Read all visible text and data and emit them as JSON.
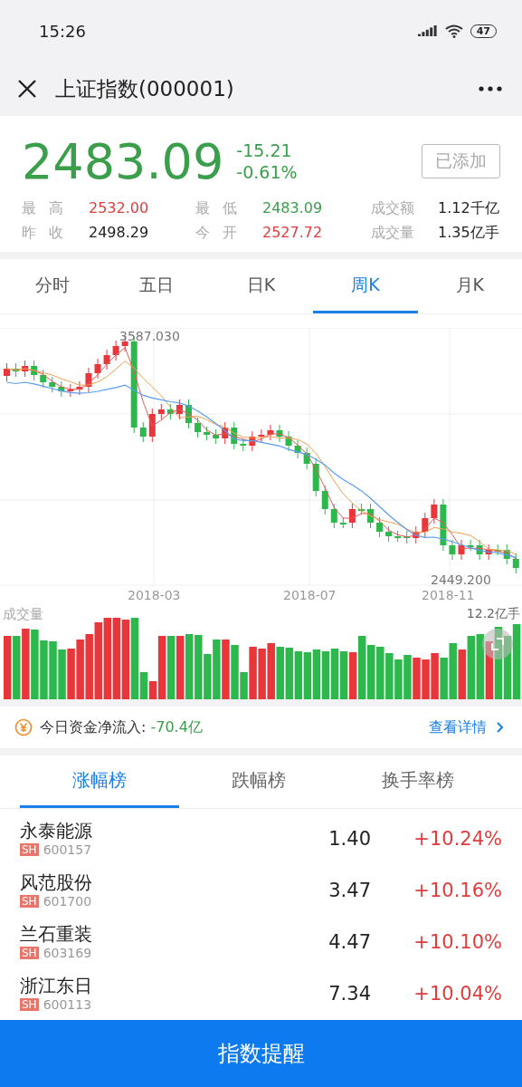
{
  "status_bar": {
    "time": "15:26",
    "battery": "47"
  },
  "header": {
    "title": "上证指数(000001)"
  },
  "quote": {
    "price": "2483.09",
    "change": "-15.21",
    "change_pct": "-0.61%",
    "color": "#3a9e4a",
    "watch_button": "已添加",
    "stats": [
      {
        "label": "最高",
        "value": "2532.00",
        "color": "#e03c3c"
      },
      {
        "label": "最低",
        "value": "2483.09",
        "color": "#3a9e4a"
      },
      {
        "label": "成交额",
        "value": "1.12千亿",
        "color": "#222222"
      },
      {
        "label": "昨收",
        "value": "2498.29",
        "color": "#222222"
      },
      {
        "label": "今开",
        "value": "2527.72",
        "color": "#e03c3c"
      },
      {
        "label": "成交量",
        "value": "1.35亿手",
        "color": "#222222"
      }
    ]
  },
  "period_tabs": [
    {
      "label": "分时",
      "selected": false
    },
    {
      "label": "五日",
      "selected": false
    },
    {
      "label": "日K",
      "selected": false
    },
    {
      "label": "周K",
      "selected": true
    },
    {
      "label": "月K",
      "selected": false
    }
  ],
  "chart": {
    "high_label": "3587.030",
    "low_label": "2449.200",
    "x_labels": [
      "2018-03",
      "2018-07",
      "2018-11"
    ],
    "volume_label": "成交量",
    "volume_max": "12.2亿手"
  },
  "fund_flow": {
    "label": "今日资金净流入:",
    "value": "-70.4亿",
    "link": "查看详情"
  },
  "rank_tabs": [
    {
      "label": "涨幅榜",
      "selected": true
    },
    {
      "label": "跌幅榜",
      "selected": false
    },
    {
      "label": "换手率榜",
      "selected": false
    }
  ],
  "stocks": [
    {
      "name": "永泰能源",
      "market": "SH",
      "code": "600157",
      "price": "1.40",
      "change": "+10.24%"
    },
    {
      "name": "风范股份",
      "market": "SH",
      "code": "601700",
      "price": "3.47",
      "change": "+10.16%"
    },
    {
      "name": "兰石重装",
      "market": "SH",
      "code": "603169",
      "price": "4.47",
      "change": "+10.10%"
    },
    {
      "name": "浙江东日",
      "market": "SH",
      "code": "600113",
      "price": "7.34",
      "change": "+10.04%"
    }
  ],
  "bottom_button": "指数提醒"
}
